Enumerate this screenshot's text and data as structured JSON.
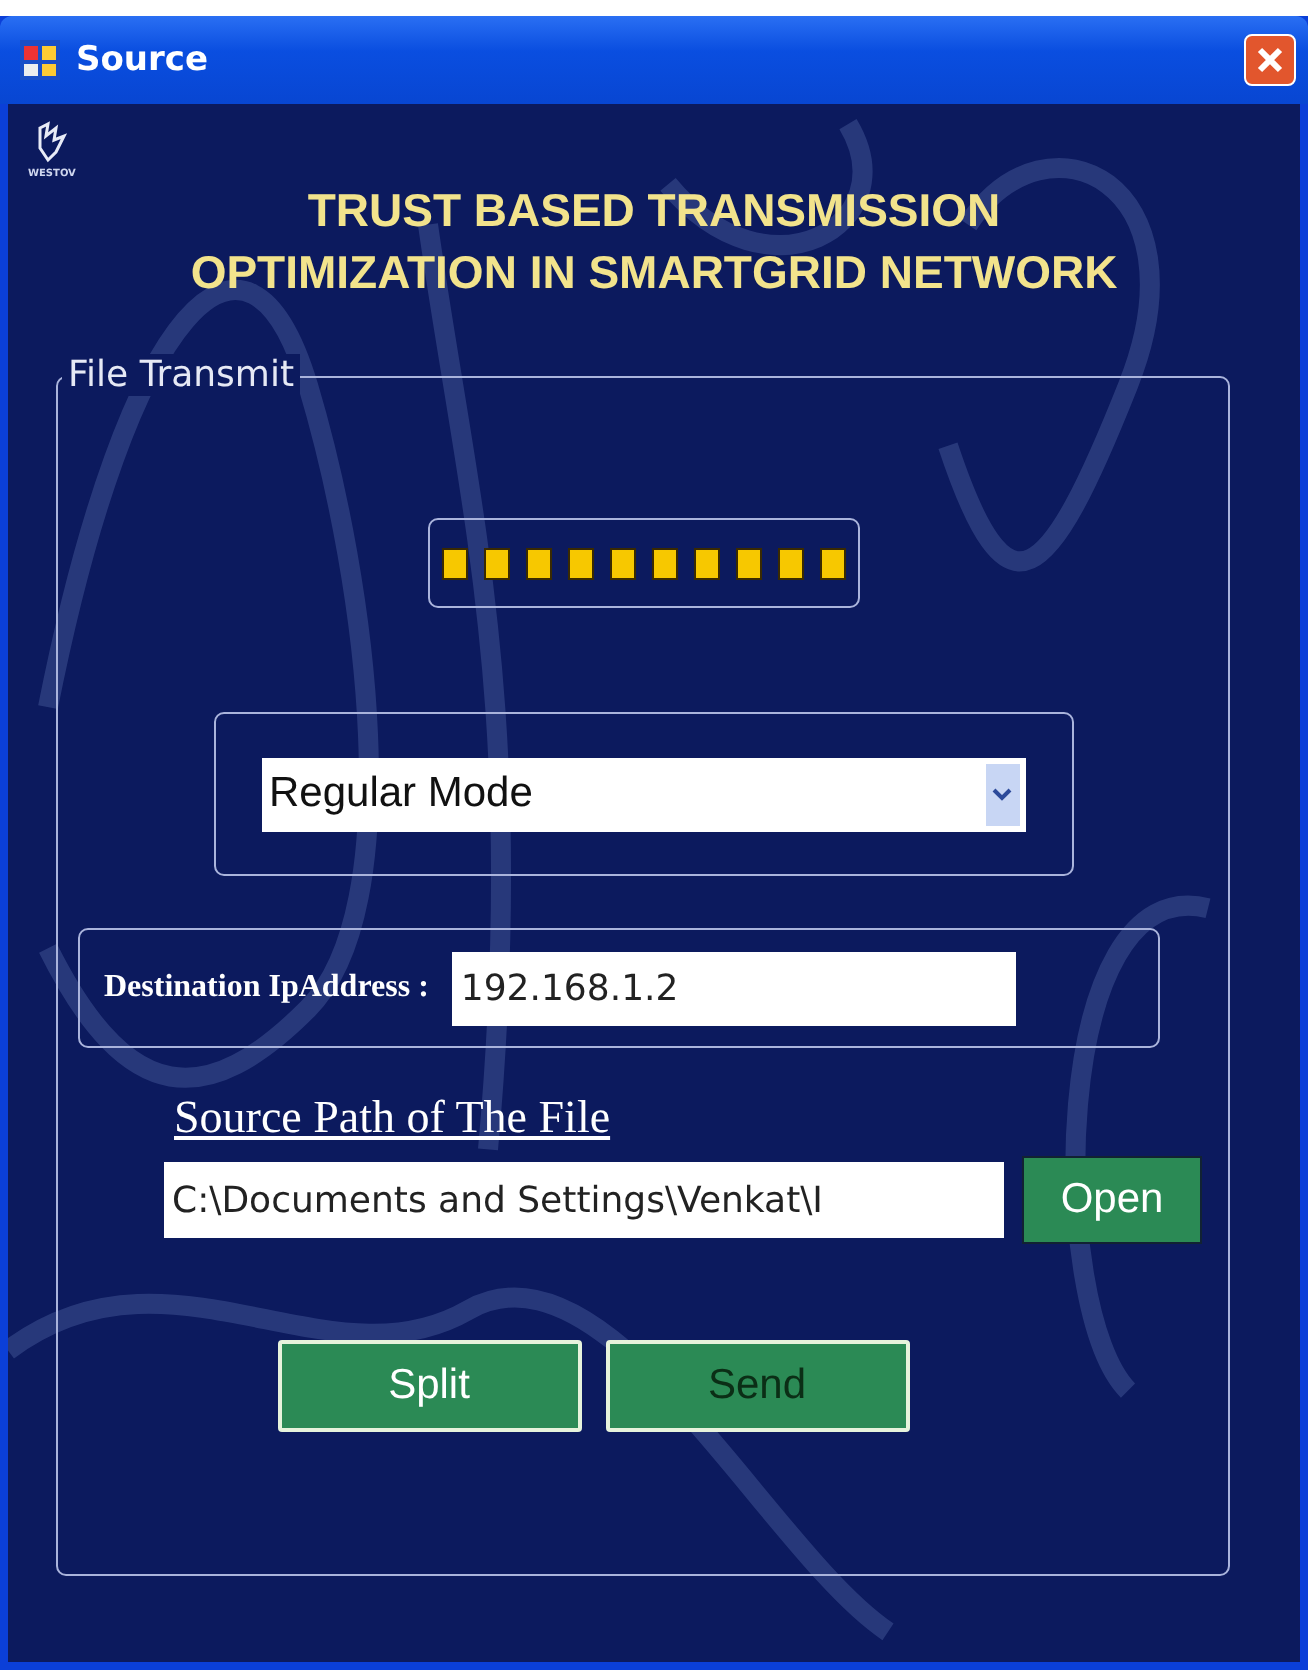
{
  "window": {
    "title": "Source"
  },
  "logo": {
    "caption": "WESTOV"
  },
  "heading": [
    "TRUST BASED TRANSMISSION",
    "OPTIMIZATION IN SMARTGRID NETWORK"
  ],
  "group": {
    "title": "File Transmit"
  },
  "progress": {
    "level": 1
  },
  "mode": {
    "value": "Regular Mode"
  },
  "destination": {
    "label": "Destination IpAddress :",
    "value": "192.168.1.2"
  },
  "source": {
    "label": "Source Path of The File",
    "value": "C:\\Documents and Settings\\Venkat\\I",
    "button": "Open"
  },
  "buttons": [
    {
      "label": "Split",
      "disabled": false
    },
    {
      "label": "Send",
      "disabled": true
    }
  ]
}
